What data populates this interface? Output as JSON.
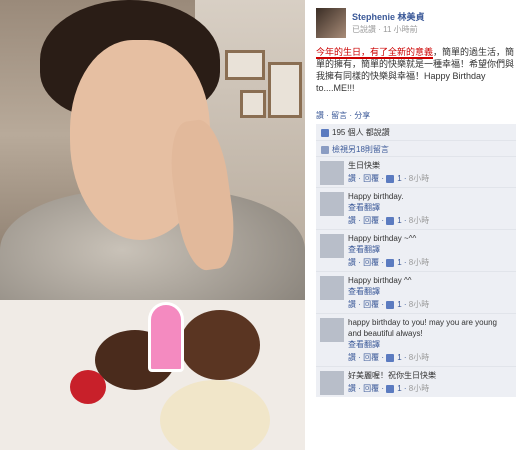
{
  "post": {
    "author": "Stephenie 林美貞",
    "verb": "已說讚",
    "time": "11 小時前",
    "text_highlight": "今年的生日，有了全新的意義",
    "text_rest": "，簡單的過生活，簡單的擁有，簡單的快樂就是一種幸福！希望你們與我擁有同樣的快樂與幸福！Happy Birthday to....ME!!!",
    "actions": "讚 · 留言 · 分享",
    "likes": "195 個人 都說讚",
    "view_more": "檢視另18則留言"
  },
  "comments": [
    {
      "text": "生日快樂",
      "see": "",
      "actions": "讚 · 回覆 · ",
      "likes": "1",
      "time": "8小時"
    },
    {
      "text": "Happy birthday.",
      "see": "查看翻譯",
      "actions": "讚 · 回覆 · ",
      "likes": "1",
      "time": "8小時"
    },
    {
      "text": "Happy birthday ~^^",
      "see": "查看翻譯",
      "actions": "讚 · 回覆 · ",
      "likes": "1",
      "time": "8小時"
    },
    {
      "text": "Happy birthday ^^",
      "see": "查看翻譯",
      "actions": "讚 · 回覆 · ",
      "likes": "1",
      "time": "8小時"
    },
    {
      "text": "happy birthday to you! may you are young and beautiful always!",
      "see": "查看翻譯",
      "actions": "讚 · 回覆 · ",
      "likes": "1",
      "time": "8小時"
    },
    {
      "text": "好美麗喔！祝你生日快樂",
      "see": "",
      "actions": "讚 · 回覆 · ",
      "likes": "1",
      "time": "8小時"
    }
  ]
}
